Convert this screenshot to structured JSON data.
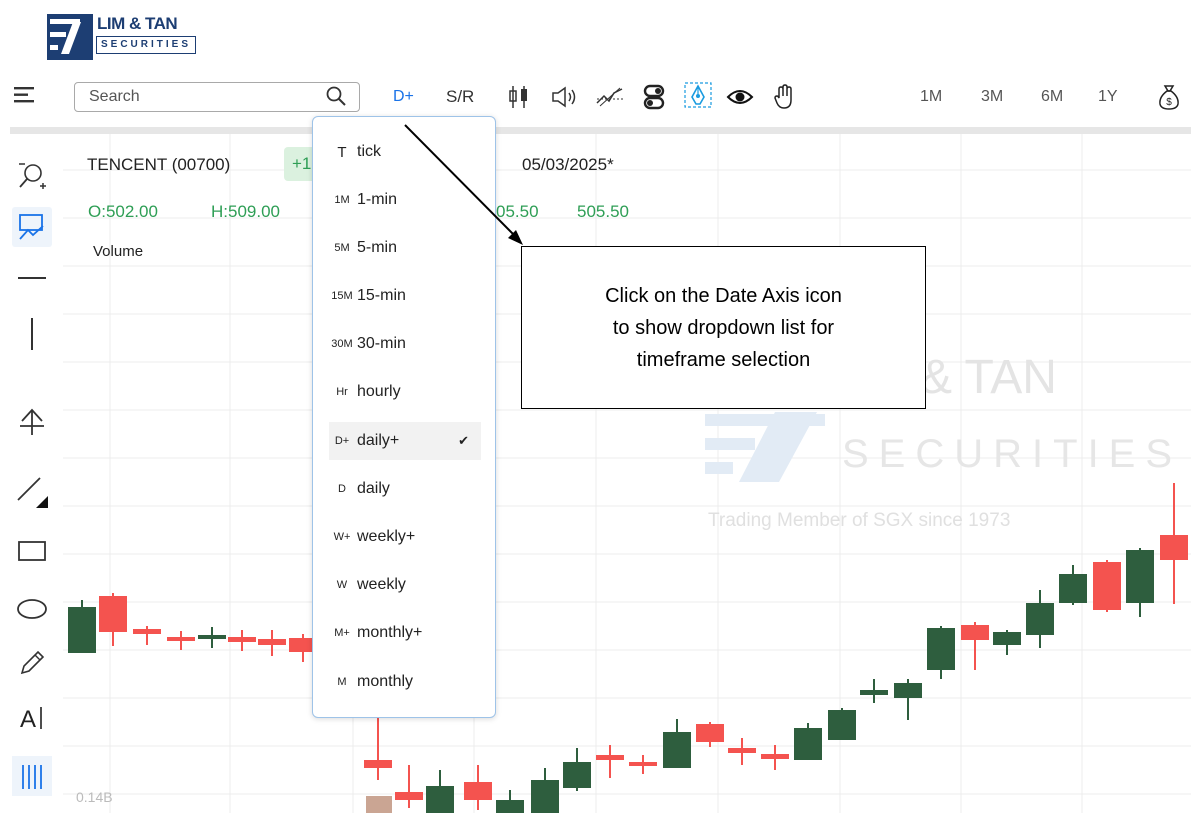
{
  "logo": {
    "line1": "LIM & TAN",
    "line2": "SECURITIES"
  },
  "toolbar": {
    "search_placeholder": "Search",
    "date_axis_label": "D+",
    "sr_label": "S/R",
    "ranges": [
      "1M",
      "3M",
      "6M",
      "1Y"
    ],
    "icons": [
      "menu-icon",
      "search-icon",
      "candle-icon",
      "sound-icon",
      "trendline-icon",
      "toggle-icon",
      "pen-tool-icon",
      "eye-icon",
      "hand-icon",
      "money-bag-icon"
    ]
  },
  "info": {
    "ticker": "TENCENT (00700)",
    "change_badge": "+1",
    "date": "05/03/2025*",
    "ohlc_open": "O:502.00",
    "ohlc_high": "H:509.00",
    "ohlc_rest_1": "05.50",
    "ohlc_rest_2": "505.50",
    "volume_label": "Volume",
    "volume_tick": "0.14B"
  },
  "watermark": {
    "line1": "& TAN",
    "line2": "SECURITIES",
    "line3": "Trading Member of SGX since 1973"
  },
  "dropdown": {
    "items": [
      {
        "code": "T",
        "label": "tick"
      },
      {
        "code": "1M",
        "label": "1-min"
      },
      {
        "code": "5M",
        "label": "5-min"
      },
      {
        "code": "15M",
        "label": "15-min"
      },
      {
        "code": "30M",
        "label": "30-min"
      },
      {
        "code": "Hr",
        "label": "hourly"
      },
      {
        "code": "D+",
        "label": "daily+",
        "selected": true
      },
      {
        "code": "D",
        "label": "daily"
      },
      {
        "code": "W+",
        "label": "weekly+"
      },
      {
        "code": "W",
        "label": "weekly"
      },
      {
        "code": "M+",
        "label": "monthly+"
      },
      {
        "code": "M",
        "label": "monthly"
      }
    ],
    "check_mark": "✔"
  },
  "callout": {
    "line1": "Click on the Date Axis icon",
    "line2": "to show dropdown list for",
    "line3": "timeframe selection"
  },
  "sidebar_tools": [
    "zoom-icon",
    "chart-draw-icon",
    "horizontal-line-icon",
    "vertical-line-icon",
    "arrow-up-icon",
    "diagonal-line-icon",
    "rectangle-icon",
    "ellipse-icon",
    "pencil-icon",
    "text-icon",
    "fibonacci-icon"
  ],
  "colors": {
    "up": "#2e5e3e",
    "down": "#f4534f",
    "accent": "#1a73e8",
    "positive_text": "#2e9e55"
  }
}
